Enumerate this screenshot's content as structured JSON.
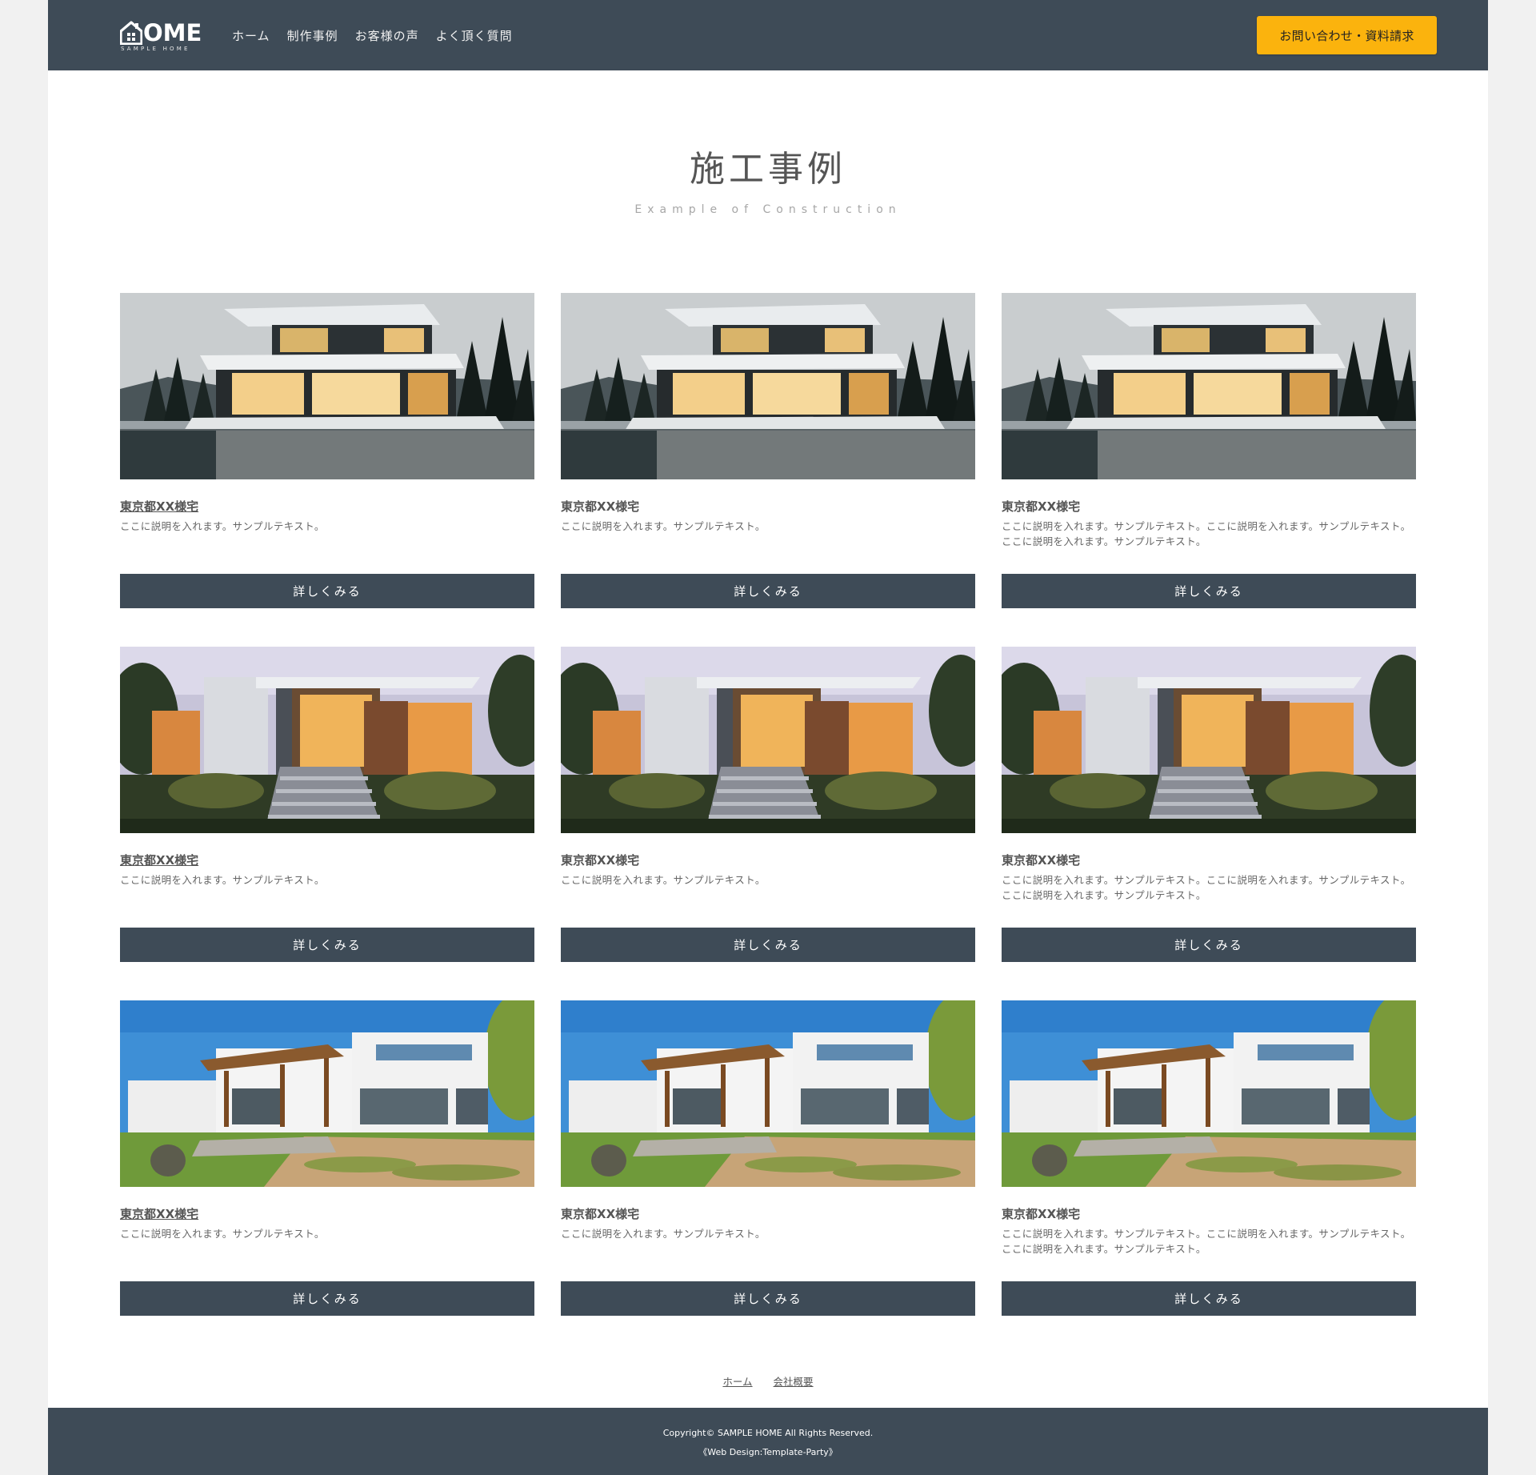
{
  "header": {
    "logo": {
      "text": "OME",
      "sub": "SAMPLE HOME"
    },
    "nav": [
      {
        "label": "ホーム"
      },
      {
        "label": "制作事例"
      },
      {
        "label": "お客様の声"
      },
      {
        "label": "よく頂く質問"
      }
    ],
    "cta_label": "お問い合わせ・資料請求"
  },
  "main": {
    "title": "施工事例",
    "subtitle": "Example of Construction",
    "cards": [
      {
        "image": "modern-house-dusk-pool",
        "title": "東京都XX様宅",
        "description": "ここに説明を入れます。サンプルテキスト。",
        "button": "詳しくみる"
      },
      {
        "image": "modern-house-dusk-pool",
        "title": "東京都XX様宅",
        "description": "ここに説明を入れます。サンプルテキスト。",
        "button": "詳しくみる"
      },
      {
        "image": "modern-house-dusk-pool",
        "title": "東京都XX様宅",
        "description": "ここに説明を入れます。サンプルテキスト。ここに説明を入れます。サンプルテキスト。ここに説明を入れます。サンプルテキスト。",
        "button": "詳しくみる"
      },
      {
        "image": "modern-house-evening-stairs",
        "title": "東京都XX様宅",
        "description": "ここに説明を入れます。サンプルテキスト。",
        "button": "詳しくみる"
      },
      {
        "image": "modern-house-evening-stairs",
        "title": "東京都XX様宅",
        "description": "ここに説明を入れます。サンプルテキスト。",
        "button": "詳しくみる"
      },
      {
        "image": "modern-house-evening-stairs",
        "title": "東京都XX様宅",
        "description": "ここに説明を入れます。サンプルテキスト。ここに説明を入れます。サンプルテキスト。ここに説明を入れます。サンプルテキスト。",
        "button": "詳しくみる"
      },
      {
        "image": "white-house-daytime-garden",
        "title": "東京都XX様宅",
        "description": "ここに説明を入れます。サンプルテキスト。",
        "button": "詳しくみる"
      },
      {
        "image": "white-house-daytime-garden",
        "title": "東京都XX様宅",
        "description": "ここに説明を入れます。サンプルテキスト。",
        "button": "詳しくみる"
      },
      {
        "image": "white-house-daytime-garden",
        "title": "東京都XX様宅",
        "description": "ここに説明を入れます。サンプルテキスト。ここに説明を入れます。サンプルテキスト。ここに説明を入れます。サンプルテキスト。",
        "button": "詳しくみる"
      }
    ]
  },
  "footer": {
    "links": [
      {
        "label": "ホーム"
      },
      {
        "label": "会社概要"
      }
    ],
    "copyright": "Copyright© SAMPLE HOME All Rights Reserved.",
    "credit": "《Web Design:Template-Party》"
  },
  "colors": {
    "header_bg": "#3e4b57",
    "accent": "#fbb30d",
    "button_bg": "#3e4b57"
  }
}
